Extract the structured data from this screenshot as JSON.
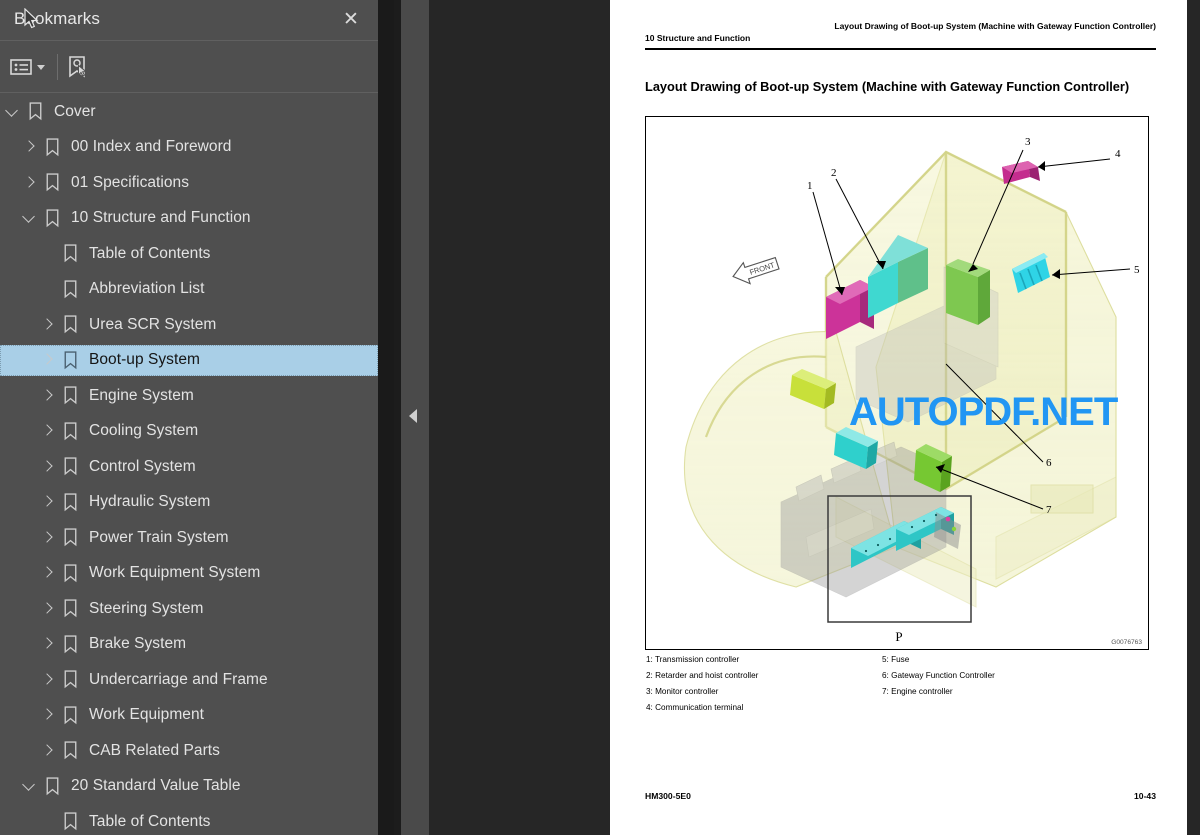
{
  "panel": {
    "title": "Bookmarks",
    "close_label": "✕",
    "toolbar": {
      "options_icon": "list-options-icon",
      "new_bookmark_icon": "new-bookmark-icon"
    }
  },
  "tree": [
    {
      "label": "Cover",
      "level": 0,
      "twisty": "down",
      "selected": false
    },
    {
      "label": "00 Index and Foreword",
      "level": 1,
      "twisty": "right",
      "selected": false
    },
    {
      "label": "01 Specifications",
      "level": 1,
      "twisty": "right",
      "selected": false
    },
    {
      "label": "10 Structure and Function",
      "level": 1,
      "twisty": "down",
      "selected": false
    },
    {
      "label": "Table of Contents",
      "level": 2,
      "twisty": "none",
      "selected": false
    },
    {
      "label": "Abbreviation List",
      "level": 2,
      "twisty": "none",
      "selected": false
    },
    {
      "label": "Urea SCR System",
      "level": 2,
      "twisty": "right",
      "selected": false
    },
    {
      "label": "Boot-up System",
      "level": 2,
      "twisty": "right",
      "selected": true
    },
    {
      "label": "Engine System",
      "level": 2,
      "twisty": "right",
      "selected": false
    },
    {
      "label": "Cooling System",
      "level": 2,
      "twisty": "right",
      "selected": false
    },
    {
      "label": "Control System",
      "level": 2,
      "twisty": "right",
      "selected": false
    },
    {
      "label": "Hydraulic System",
      "level": 2,
      "twisty": "right",
      "selected": false
    },
    {
      "label": "Power Train System",
      "level": 2,
      "twisty": "right",
      "selected": false
    },
    {
      "label": "Work Equipment System",
      "level": 2,
      "twisty": "right",
      "selected": false
    },
    {
      "label": "Steering System",
      "level": 2,
      "twisty": "right",
      "selected": false
    },
    {
      "label": "Brake System",
      "level": 2,
      "twisty": "right",
      "selected": false
    },
    {
      "label": "Undercarriage and Frame",
      "level": 2,
      "twisty": "right",
      "selected": false
    },
    {
      "label": "Work Equipment",
      "level": 2,
      "twisty": "right",
      "selected": false
    },
    {
      "label": "CAB Related Parts",
      "level": 2,
      "twisty": "right",
      "selected": false
    },
    {
      "label": "20 Standard Value Table",
      "level": 1,
      "twisty": "down",
      "selected": false
    },
    {
      "label": "Table of Contents",
      "level": 2,
      "twisty": "none",
      "selected": false
    }
  ],
  "watermark": {
    "text_a": "AUTOPDF",
    "text_b": ".NET"
  },
  "document": {
    "header_left": "10 Structure and Function",
    "header_right": "Layout Drawing of Boot-up System (Machine with Gateway Function Controller)",
    "title": "Layout Drawing of Boot-up System (Machine with Gateway Function Controller)",
    "figure_code": "G0076763",
    "detail_label": "P",
    "front_label": "FRONT",
    "callouts": [
      "1",
      "2",
      "3",
      "4",
      "5",
      "6",
      "7"
    ],
    "legend_col1": [
      "1: Transmission controller",
      "2: Retarder and hoist controller",
      "3: Monitor controller",
      "4: Communication terminal"
    ],
    "legend_col2": [
      "5: Fuse",
      "6: Gateway Function Controller",
      "7: Engine controller"
    ],
    "footer_left": "HM300-5E0",
    "footer_right": "10-43"
  },
  "colors": {
    "panel_bg": "#4f4f4f",
    "selection": "#a9cfe7",
    "watermark": "#2196f3",
    "viewer_bg": "#262626"
  }
}
